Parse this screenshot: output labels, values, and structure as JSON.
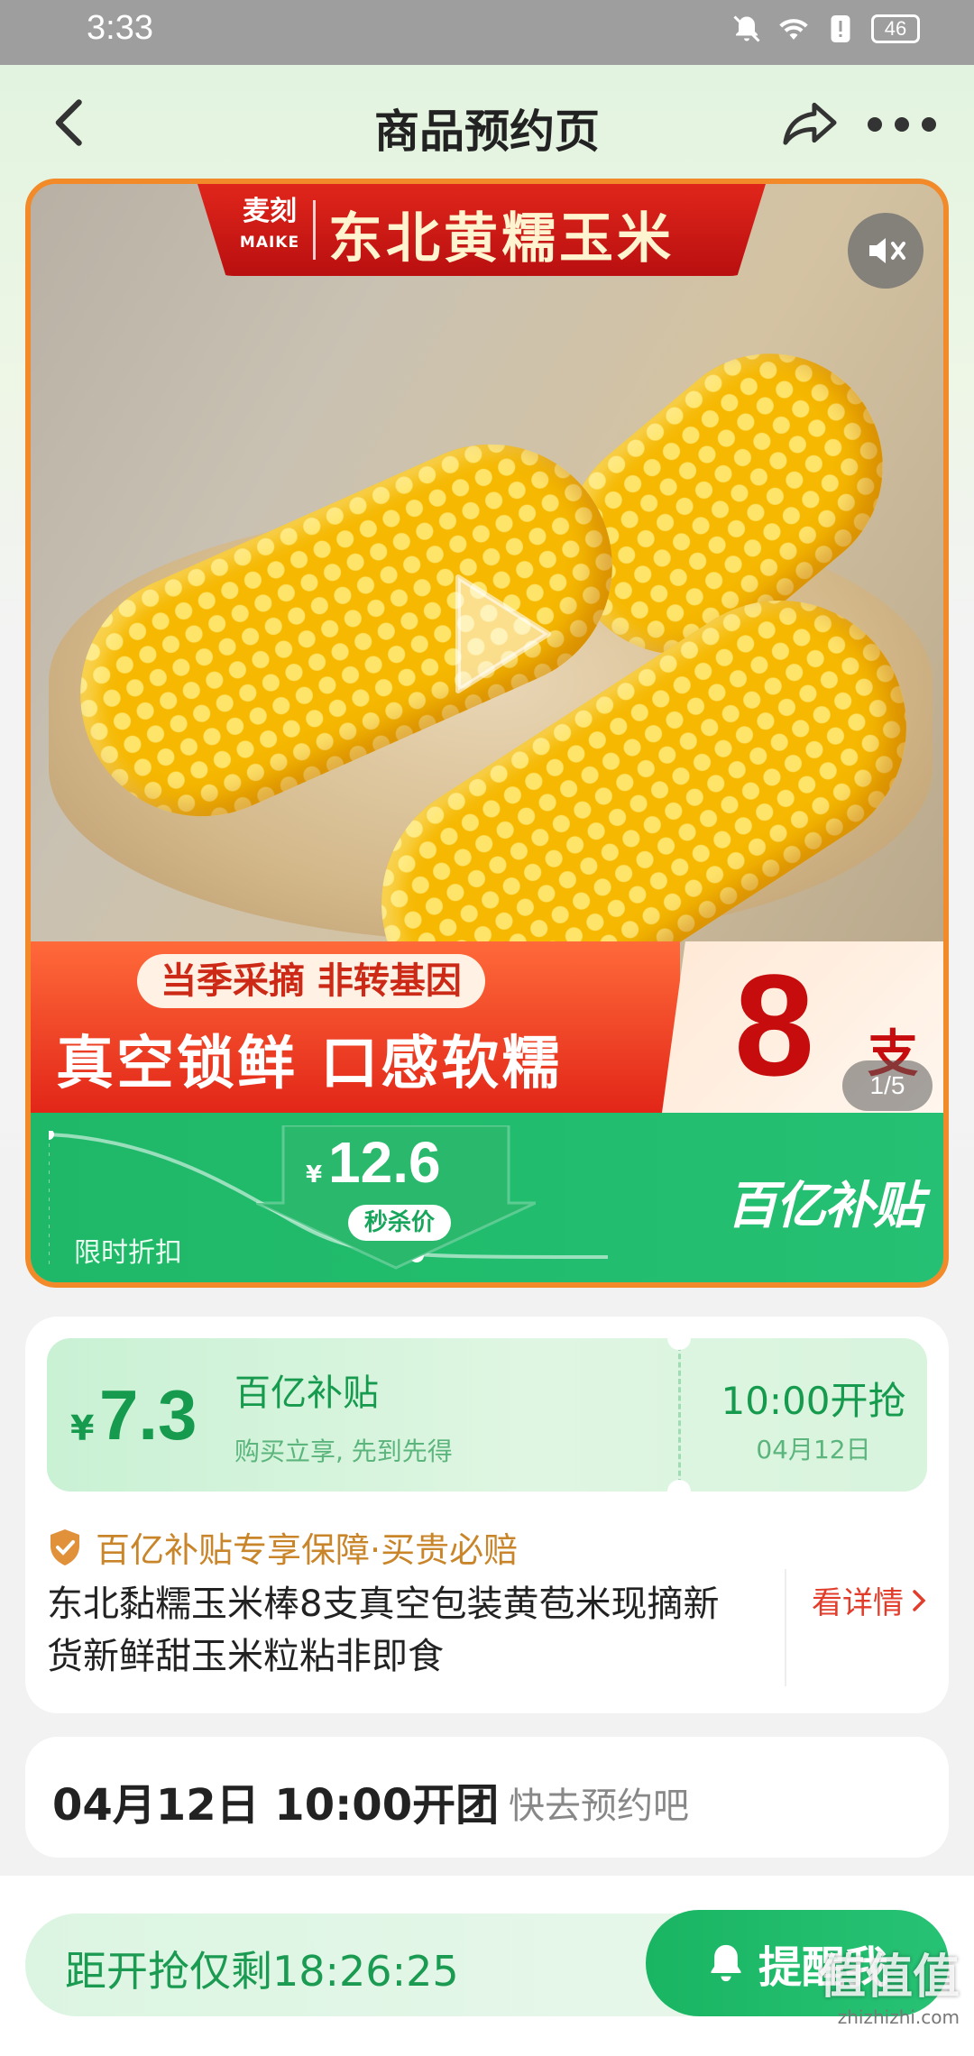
{
  "status_bar": {
    "time": "3:33",
    "battery": "46"
  },
  "nav": {
    "title": "商品预约页"
  },
  "hero": {
    "brand_logo_text": "麦刻",
    "brand_logo_sub": "MAIKE",
    "brand_name": "东北黄糯玉米",
    "promo_tag": "当季采摘 非转基因",
    "promo_main": "真空锁鲜 口感软糯",
    "count": "8",
    "count_unit": "支",
    "pager": "1/5"
  },
  "price_bar": {
    "discount_label": "限时折扣",
    "currency": "¥",
    "price": "12.6",
    "seckill_label": "秒杀价",
    "subsidy_logo": "百亿补贴"
  },
  "coupon": {
    "currency": "¥",
    "amount": "7.3",
    "title": "百亿补贴",
    "subtitle": "购买立享, 先到先得",
    "start_time": "10:00开抢",
    "start_date": "04月12日"
  },
  "product": {
    "guarantee": "百亿补贴专享保障·买贵必赔",
    "title": "东北黏糯玉米棒8支真空包装黄苞米现摘新货新鲜甜玉米粒粘非即食",
    "detail_link": "看详情"
  },
  "group": {
    "datetime": "04月12日 10:00开团",
    "hint": "快去预约吧"
  },
  "bottom": {
    "countdown": "距开抢仅剩18:26:25",
    "remind_label": "提醒我"
  },
  "watermark": {
    "text": "值值值",
    "sub": "zhizhizhi.com"
  },
  "colors": {
    "accent_green": "#1fb868",
    "accent_red": "#e22618",
    "gold": "#c9852a"
  }
}
